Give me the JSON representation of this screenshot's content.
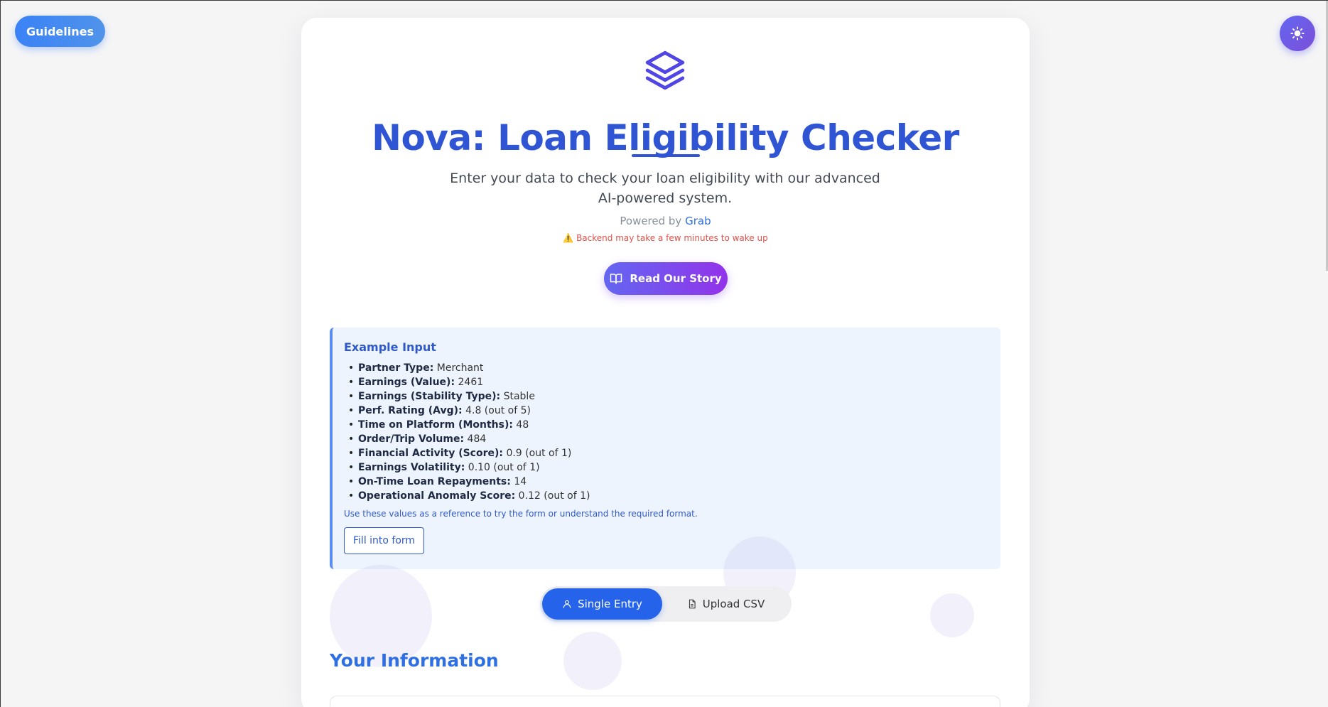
{
  "header": {
    "guidelines_label": "Guidelines",
    "theme_icon": "sun-icon"
  },
  "hero": {
    "icon": "layers-icon",
    "title": "Nova: Loan Eligibility Checker",
    "subtitle": "Enter your data to check your loan eligibility with our advanced AI-powered system.",
    "powered_prefix": "Powered by",
    "powered_brand": "Grab",
    "warning": "Backend may take a few minutes to wake up",
    "story_button": "Read Our Story"
  },
  "example": {
    "title": "Example Input",
    "items": [
      {
        "key": "Partner Type:",
        "value": "Merchant"
      },
      {
        "key": "Earnings (Value):",
        "value": "2461"
      },
      {
        "key": "Earnings (Stability Type):",
        "value": "Stable"
      },
      {
        "key": "Perf. Rating (Avg):",
        "value": "4.8 (out of 5)"
      },
      {
        "key": "Time on Platform (Months):",
        "value": "48"
      },
      {
        "key": "Order/Trip Volume:",
        "value": "484"
      },
      {
        "key": "Financial Activity (Score):",
        "value": "0.9 (out of 1)"
      },
      {
        "key": "Earnings Volatility:",
        "value": "0.10 (out of 1)"
      },
      {
        "key": "On-Time Loan Repayments:",
        "value": "14"
      },
      {
        "key": "Operational Anomaly Score:",
        "value": "0.12 (out of 1)"
      }
    ],
    "note": "Use these values as a reference to try the form or understand the required format.",
    "fill_button": "Fill into form"
  },
  "mode_toggle": {
    "single": "Single Entry",
    "csv": "Upload CSV",
    "selected": "Single Entry"
  },
  "form": {
    "section_title": "Your Information"
  },
  "colors": {
    "primary": "#2f55d4",
    "accent_purple": "#9333ea",
    "warning": "#e0504a",
    "background": "#f5f5f6"
  }
}
